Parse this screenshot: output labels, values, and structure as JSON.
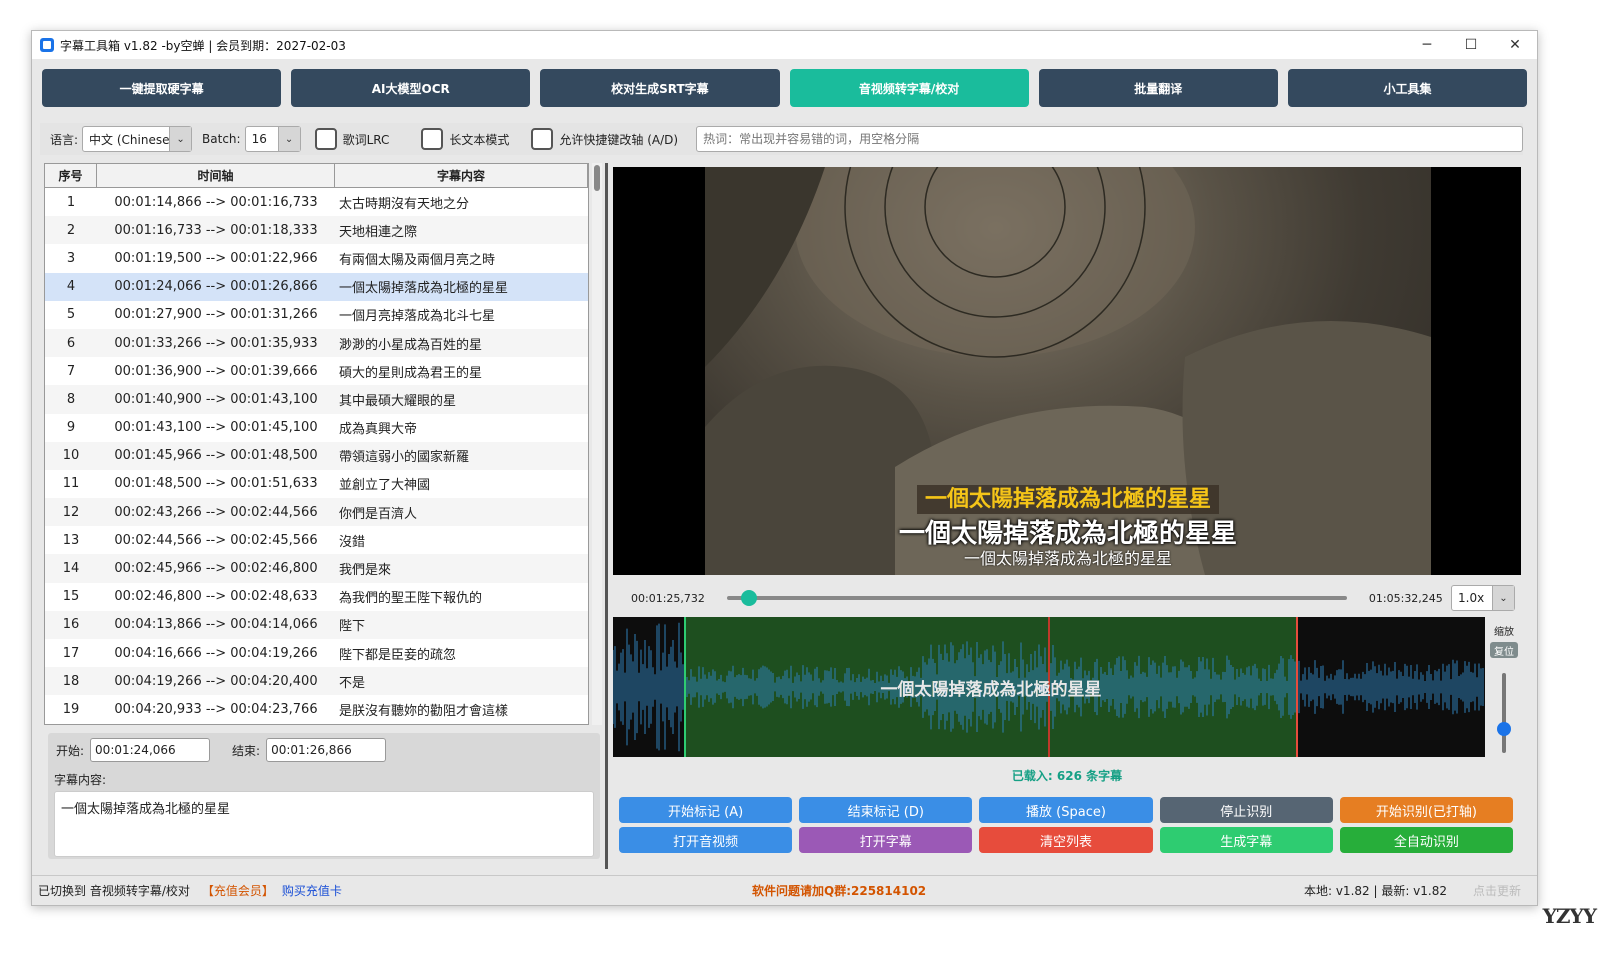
{
  "window": {
    "title": "字幕工具箱 v1.82 -by空蝉 | 会员到期：2027-02-03",
    "minimize": "─",
    "maximize": "☐",
    "close": "✕"
  },
  "toolbar": [
    {
      "label": "一键提取硬字幕",
      "active": false
    },
    {
      "label": "AI大模型OCR",
      "active": false
    },
    {
      "label": "校对生成SRT字幕",
      "active": false
    },
    {
      "label": "音视频转字幕/校对",
      "active": true
    },
    {
      "label": "批量翻译",
      "active": false
    },
    {
      "label": "小工具集",
      "active": false
    }
  ],
  "options": {
    "language_label": "语言:",
    "language_value": "中文 (Chinese",
    "batch_label": "Batch:",
    "batch_value": "16",
    "lrc_label": "歌词LRC",
    "long_text_label": "长文本模式",
    "shortcut_label": "允许快捷键改轴 (A/D)",
    "hotwords_placeholder": "热词：常出现并容易错的词，用空格分隔"
  },
  "table": {
    "headers": [
      "序号",
      "时间轴",
      "字幕内容"
    ],
    "selected_index": 3,
    "rows": [
      [
        "1",
        "00:01:14,866 --> 00:01:16,733",
        "太古時期沒有天地之分"
      ],
      [
        "2",
        "00:01:16,733 --> 00:01:18,333",
        "天地相連之際"
      ],
      [
        "3",
        "00:01:19,500 --> 00:01:22,966",
        "有兩個太陽及兩個月亮之時"
      ],
      [
        "4",
        "00:01:24,066 --> 00:01:26,866",
        "一個太陽掉落成為北極的星星"
      ],
      [
        "5",
        "00:01:27,900 --> 00:01:31,266",
        "一個月亮掉落成為北斗七星"
      ],
      [
        "6",
        "00:01:33,266 --> 00:01:35,933",
        "渺渺的小星成為百姓的星"
      ],
      [
        "7",
        "00:01:36,900 --> 00:01:39,666",
        "碩大的星則成為君王的星"
      ],
      [
        "8",
        "00:01:40,900 --> 00:01:43,100",
        "其中最碩大耀眼的星"
      ],
      [
        "9",
        "00:01:43,100 --> 00:01:45,100",
        "成為真興大帝"
      ],
      [
        "10",
        "00:01:45,966 --> 00:01:48,500",
        "帶領這弱小的國家新羅"
      ],
      [
        "11",
        "00:01:48,500 --> 00:01:51,633",
        "並創立了大神國"
      ],
      [
        "12",
        "00:02:43,266 --> 00:02:44,566",
        "你們是百濟人"
      ],
      [
        "13",
        "00:02:44,566 --> 00:02:45,566",
        "沒錯"
      ],
      [
        "14",
        "00:02:45,966 --> 00:02:46,800",
        "我們是來"
      ],
      [
        "15",
        "00:02:46,800 --> 00:02:48,633",
        "為我們的聖王陛下報仇的"
      ],
      [
        "16",
        "00:04:13,866 --> 00:04:14,066",
        "陛下"
      ],
      [
        "17",
        "00:04:16,666 --> 00:04:19,266",
        "陛下都是臣妾的疏忽"
      ],
      [
        "18",
        "00:04:19,266 --> 00:04:20,400",
        "不是"
      ],
      [
        "19",
        "00:04:20,933 --> 00:04:23,766",
        "是朕沒有聽妳的勸阻才會這樣"
      ]
    ]
  },
  "editor": {
    "start_label": "开始:",
    "start_value": "00:01:24,066",
    "end_label": "结束:",
    "end_value": "00:01:26,866",
    "content_label": "字幕内容:",
    "content_value": "一個太陽掉落成為北極的星星"
  },
  "video": {
    "subtitle_top": "一個太陽掉落成為北極的星星",
    "subtitle_mid": "一個太陽掉落成為北極的星星",
    "subtitle_bottom": "一個太陽掉落成為北極的星星"
  },
  "player": {
    "current_time": "00:01:25,732",
    "total_time": "01:05:32,245",
    "progress": 0.022,
    "speed": "1.0x"
  },
  "waveform": {
    "label": "一個太陽掉落成為北極的星星",
    "zoom_label": "缩放",
    "reset_label": "复位",
    "zoom_level": 0.7
  },
  "loaded_text": "已载入: 626 条字幕",
  "actions": [
    {
      "label": "开始标记 (A)",
      "color": "#3a8ee6"
    },
    {
      "label": "结束标记 (D)",
      "color": "#3a8ee6"
    },
    {
      "label": "播放 (Space)",
      "color": "#3a8ee6"
    },
    {
      "label": "停止识别",
      "color": "#566573"
    },
    {
      "label": "开始识别(已打轴)",
      "color": "#e67e22"
    },
    {
      "label": "打开音视频",
      "color": "#3a8ee6"
    },
    {
      "label": "打开字幕",
      "color": "#9b59b6"
    },
    {
      "label": "清空列表",
      "color": "#e74c3c"
    },
    {
      "label": "生成字幕",
      "color": "#2ecc71"
    },
    {
      "label": "全自动识别",
      "color": "#27ae3a"
    }
  ],
  "status": {
    "left": "已切换到 音视频转字幕/校对",
    "vip": "【充值会员】",
    "buy": "购买充值卡",
    "center": "软件问题请加Q群:225814102",
    "version": "本地: v1.82 | 最新: v1.82",
    "update": "点击更新"
  },
  "watermark": "YZYY"
}
